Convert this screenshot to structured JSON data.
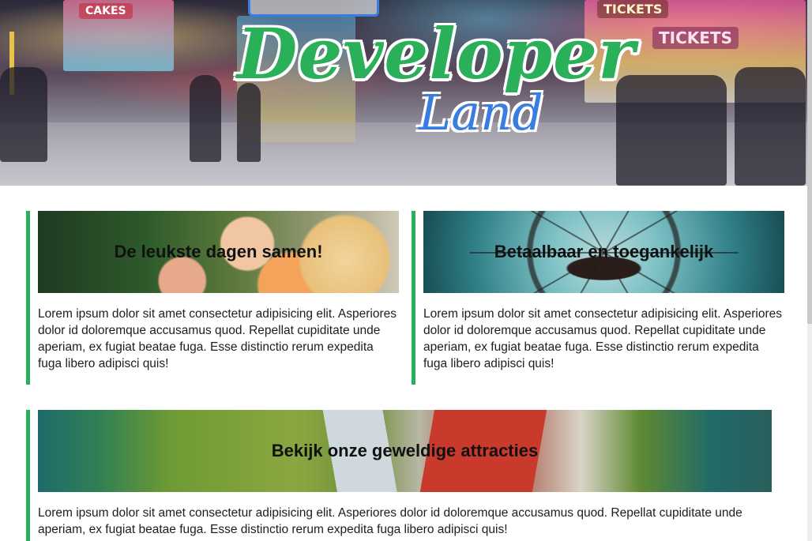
{
  "hero": {
    "logo_main": "Developer",
    "logo_sub": "Land",
    "signs": [
      "TICKETS",
      "TICKETS",
      "CAKES"
    ]
  },
  "cards": [
    {
      "title": "De leukste dagen samen!",
      "text": "Lorem ipsum dolor sit amet consectetur adipisicing elit. Asperiores dolor id doloremque accusamus quod. Repellat cupiditate unde aperiam, ex fugiat beatae fuga. Esse distinctio rerum expedita fuga libero adipisci quis!"
    },
    {
      "title": "Betaalbaar en toegankelijk",
      "text": "Lorem ipsum dolor sit amet consectetur adipisicing elit. Asperiores dolor id doloremque accusamus quod. Repellat cupiditate unde aperiam, ex fugiat beatae fuga. Esse distinctio rerum expedita fuga libero adipisci quis!"
    },
    {
      "title": "Bekijk onze geweldige attracties",
      "text": "Lorem ipsum dolor sit amet consectetur adipisicing elit. Asperiores dolor id doloremque accusamus quod. Repellat cupiditate unde aperiam, ex fugiat beatae fuga. Esse distinctio rerum expedita fuga libero adipisci quis!"
    }
  ],
  "colors": {
    "accent_green": "#2bb05a",
    "logo_blue": "#3a7de0",
    "text": "#1d1d1d"
  }
}
